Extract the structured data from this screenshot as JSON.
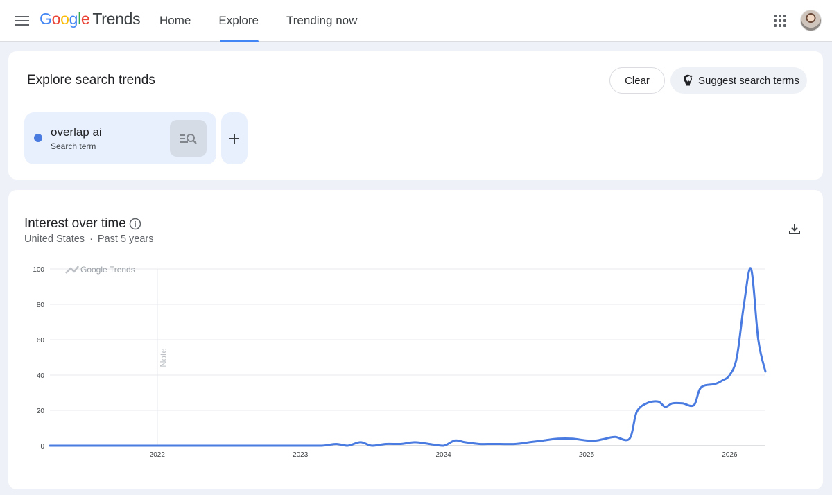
{
  "header": {
    "logo_google": [
      "G",
      "o",
      "o",
      "g",
      "l",
      "e"
    ],
    "logo_colors": [
      "#4285f4",
      "#ea4335",
      "#fbbc05",
      "#4285f4",
      "#34a853",
      "#ea4335"
    ],
    "logo_product": "Trends",
    "nav": [
      {
        "label": "Home",
        "active": false
      },
      {
        "label": "Explore",
        "active": true
      },
      {
        "label": "Trending now",
        "active": false
      }
    ]
  },
  "explore": {
    "title": "Explore search trends",
    "clear_label": "Clear",
    "suggest_label": "Suggest search terms",
    "term": {
      "name": "overlap ai",
      "type": "Search term",
      "color": "#4a7be0"
    }
  },
  "interest": {
    "title": "Interest over time",
    "region": "United States",
    "separator": "·",
    "period": "Past 5 years"
  },
  "chart_data": {
    "type": "line",
    "watermark": "Google Trends",
    "note_label": "Note",
    "ylim": [
      0,
      100
    ],
    "y_ticks": [
      0,
      20,
      40,
      60,
      80,
      100
    ],
    "x_tick_labels": [
      "2022",
      "2023",
      "2024",
      "2025",
      "2026"
    ],
    "x_tick_values": [
      2022.0,
      2023.0,
      2024.0,
      2025.0,
      2026.0
    ],
    "xlim": [
      2021.25,
      2026.25
    ],
    "note_x": 2022.0,
    "series": [
      {
        "color": "#4a7be0",
        "x": [
          2021.25,
          2022.0,
          2023.0,
          2023.15,
          2023.25,
          2023.33,
          2023.42,
          2023.5,
          2023.6,
          2023.7,
          2023.8,
          2023.9,
          2024.0,
          2024.08,
          2024.15,
          2024.25,
          2024.35,
          2024.5,
          2024.6,
          2024.7,
          2024.8,
          2024.9,
          2025.0,
          2025.07,
          2025.13,
          2025.2,
          2025.3,
          2025.35,
          2025.42,
          2025.5,
          2025.55,
          2025.6,
          2025.67,
          2025.75,
          2025.8,
          2025.9,
          2025.95,
          2026.0,
          2026.05,
          2026.1,
          2026.15,
          2026.2,
          2026.25
        ],
        "y": [
          0,
          0,
          0,
          0,
          1,
          0,
          2,
          0,
          1,
          1,
          2,
          1,
          0,
          3,
          2,
          1,
          1,
          1,
          2,
          3,
          4,
          4,
          3,
          3,
          4,
          5,
          4,
          19,
          24,
          25,
          22,
          24,
          24,
          23,
          33,
          35,
          37,
          40,
          50,
          80,
          100,
          60,
          42
        ]
      }
    ]
  }
}
